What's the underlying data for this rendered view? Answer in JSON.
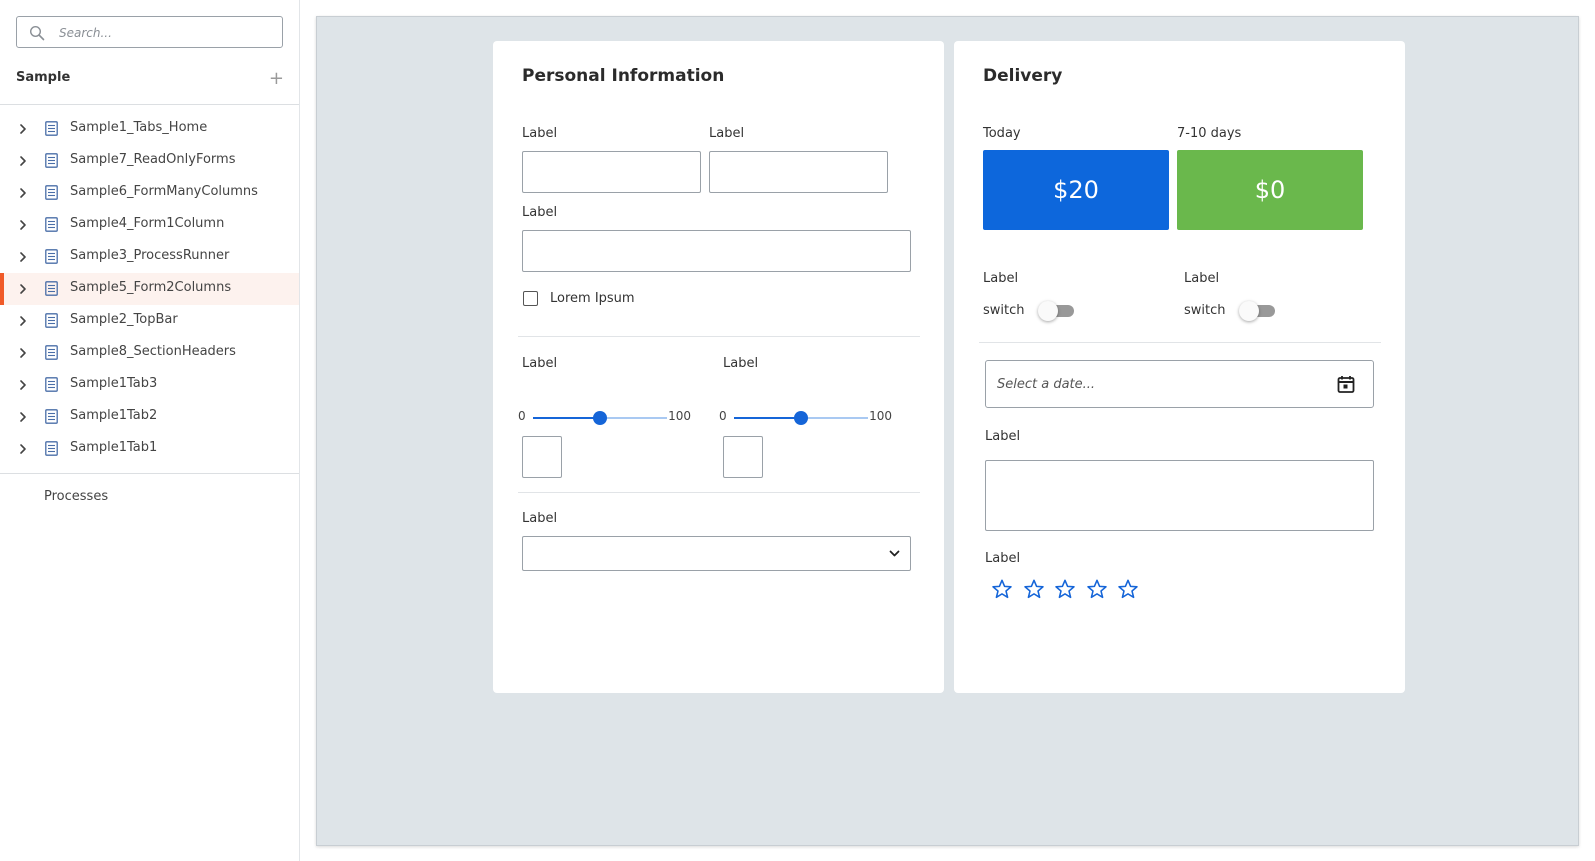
{
  "sidebar": {
    "search": {
      "placeholder": "Search..."
    },
    "section_title": "Sample",
    "add_icon": "plus-icon",
    "items": [
      {
        "label": "Sample1_Tabs_Home",
        "active": false
      },
      {
        "label": "Sample7_ReadOnlyForms",
        "active": false
      },
      {
        "label": "Sample6_FormManyColumns",
        "active": false
      },
      {
        "label": "Sample4_Form1Column",
        "active": false
      },
      {
        "label": "Sample3_ProcessRunner",
        "active": false
      },
      {
        "label": "Sample5_Form2Columns",
        "active": true
      },
      {
        "label": "Sample2_TopBar",
        "active": false
      },
      {
        "label": "Sample8_SectionHeaders",
        "active": false
      },
      {
        "label": "Sample1Tab3",
        "active": false
      },
      {
        "label": "Sample1Tab2",
        "active": false
      },
      {
        "label": "Sample1Tab1",
        "active": false
      }
    ],
    "processes_label": "Processes",
    "active_accent": "#f05a28"
  },
  "personal": {
    "title": "Personal Information",
    "label1": "Label",
    "label2": "Label",
    "label3": "Label",
    "checkbox_label": "Lorem Ipsum",
    "slider1": {
      "label": "Label",
      "min": "0",
      "max": "100",
      "value": 50
    },
    "slider2": {
      "label": "Label",
      "min": "0",
      "max": "100",
      "value": 50
    },
    "select_label": "Label"
  },
  "delivery": {
    "title": "Delivery",
    "options": [
      {
        "label": "Today",
        "price": "$20",
        "color": "#0d67dc"
      },
      {
        "label": "7-10 days",
        "price": "$0",
        "color": "#6ab84c"
      }
    ],
    "switch1": {
      "label": "Label",
      "text": "switch",
      "on": false
    },
    "switch2": {
      "label": "Label",
      "text": "switch",
      "on": false
    },
    "date_placeholder": "Select a date...",
    "textarea_label": "Label",
    "rating_label": "Label",
    "rating": {
      "max": 5,
      "value": 0,
      "color": "#1565d8"
    }
  },
  "colors": {
    "canvas_bg": "#dee4e8",
    "primary": "#1565d8"
  }
}
